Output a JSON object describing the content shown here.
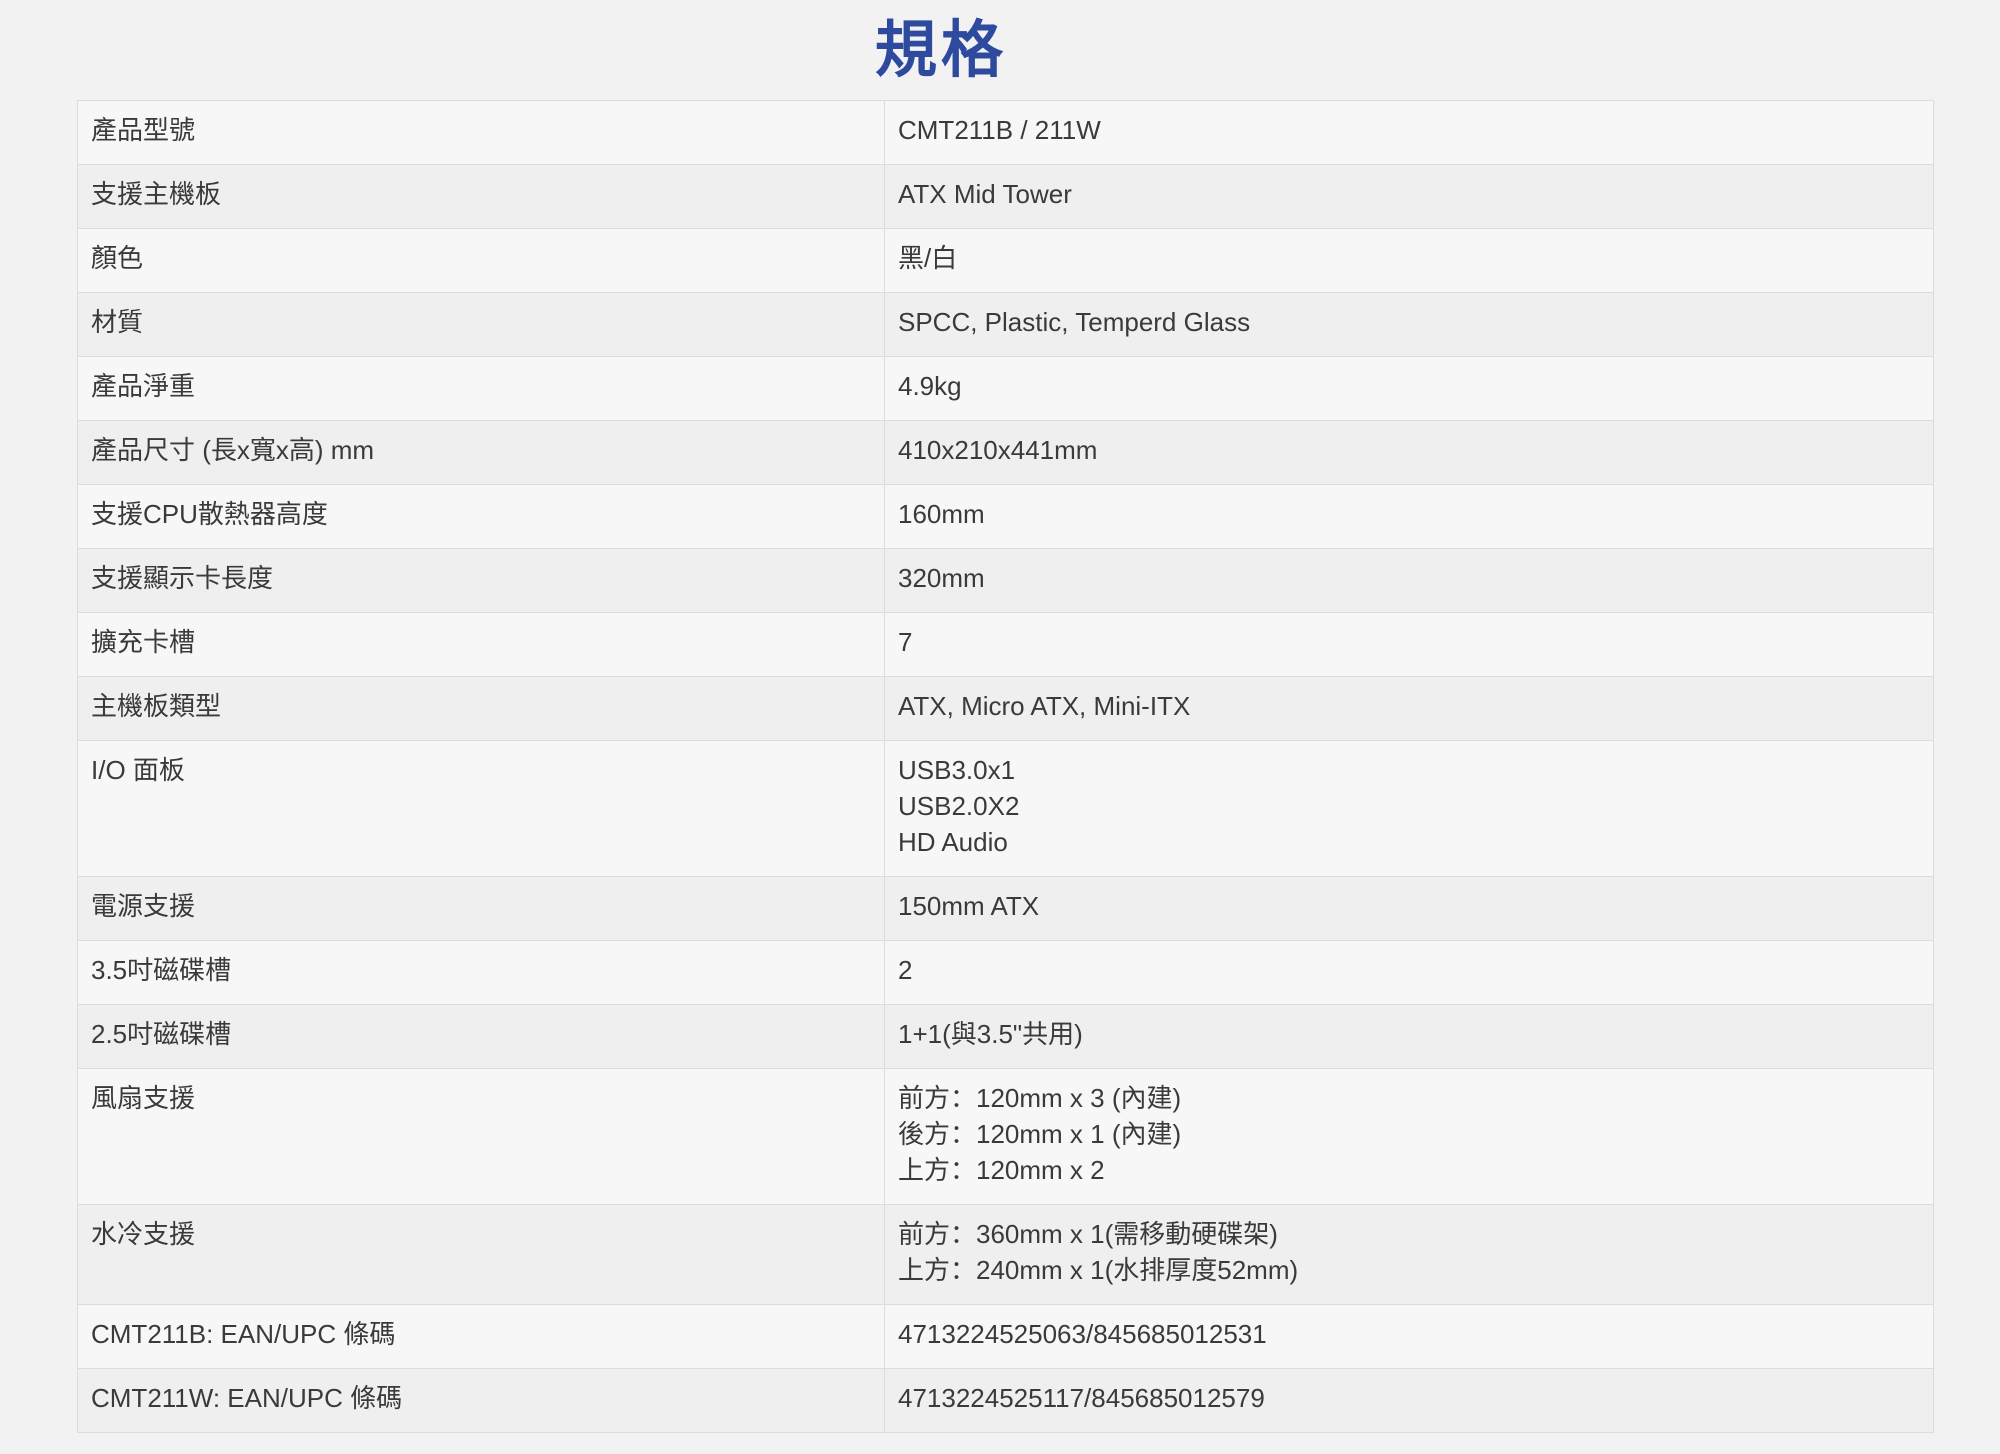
{
  "title": "規格",
  "specs": [
    {
      "label": "產品型號",
      "value": [
        "CMT211B / 211W"
      ]
    },
    {
      "label": "支援主機板",
      "value": [
        "ATX Mid Tower"
      ]
    },
    {
      "label": "顏色",
      "value": [
        "黑/白"
      ]
    },
    {
      "label": "材質",
      "value": [
        "SPCC, Plastic, Temperd Glass"
      ]
    },
    {
      "label": "產品淨重",
      "value": [
        "4.9kg"
      ]
    },
    {
      "label": "產品尺寸 (長x寬x高) mm",
      "value": [
        "410x210x441mm"
      ]
    },
    {
      "label": "支援CPU散熱器高度",
      "value": [
        "160mm"
      ]
    },
    {
      "label": "支援顯示卡長度",
      "value": [
        "320mm"
      ]
    },
    {
      "label": "擴充卡槽",
      "value": [
        "7"
      ]
    },
    {
      "label": "主機板類型",
      "value": [
        "ATX, Micro ATX, Mini-ITX"
      ]
    },
    {
      "label": "I/O 面板",
      "value": [
        "USB3.0x1",
        "USB2.0X2",
        "HD Audio"
      ]
    },
    {
      "label": "電源支援",
      "value": [
        "150mm ATX"
      ]
    },
    {
      "label": "3.5吋磁碟槽",
      "value": [
        "2"
      ]
    },
    {
      "label": "2.5吋磁碟槽",
      "value": [
        "1+1(與3.5\"共用)"
      ]
    },
    {
      "label": "風扇支援",
      "value": [
        "前方：120mm x 3 (內建)",
        "後方：120mm x 1 (內建)",
        "上方：120mm x 2"
      ]
    },
    {
      "label": "水冷支援",
      "value": [
        "前方：360mm x 1(需移動硬碟架)",
        "上方：240mm x 1(水排厚度52mm)"
      ]
    },
    {
      "label": "CMT211B: EAN/UPC 條碼",
      "value": [
        "4713224525063/845685012531"
      ]
    },
    {
      "label": "CMT211W: EAN/UPC 條碼",
      "value": [
        "4713224525117/845685012579"
      ]
    }
  ]
}
